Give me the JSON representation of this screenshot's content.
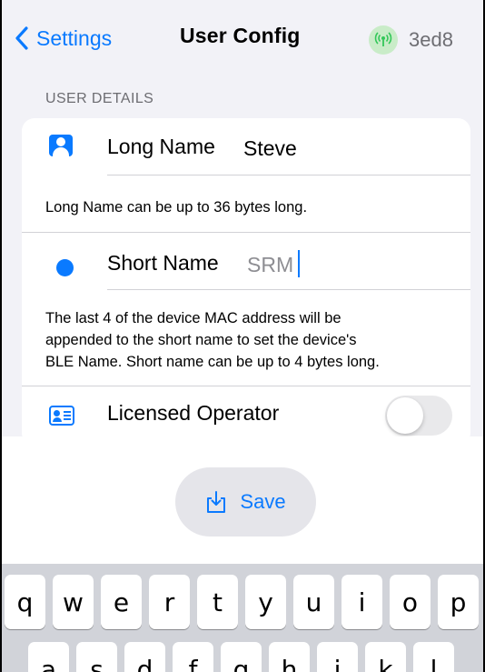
{
  "navbar": {
    "back_label": "Settings",
    "title": "User Config",
    "node_id": "3ed8"
  },
  "section": {
    "header": "USER DETAILS"
  },
  "long_name": {
    "label": "Long Name",
    "value": "Steve",
    "note": "Long Name can be up to 36 bytes long."
  },
  "short_name": {
    "label": "Short Name",
    "placeholder": "SRM",
    "note_lines": [
      "The last 4 of the device MAC address will be",
      "appended to the short name to set the device's",
      "BLE Name.  Short name can be up to 4 bytes long."
    ]
  },
  "licensed_operator": {
    "label": "Licensed Operator",
    "enabled": false
  },
  "save": {
    "label": "Save"
  },
  "keyboard": {
    "row1": [
      "q",
      "w",
      "e",
      "r",
      "t",
      "y",
      "u",
      "i",
      "o",
      "p"
    ],
    "row2": [
      "a",
      "s",
      "d",
      "f",
      "g",
      "h",
      "j",
      "k",
      "l"
    ]
  },
  "colors": {
    "accent": "#0a7aff",
    "node_badge": "#c9ecc8",
    "grouped_background": "#f2f2f7"
  }
}
